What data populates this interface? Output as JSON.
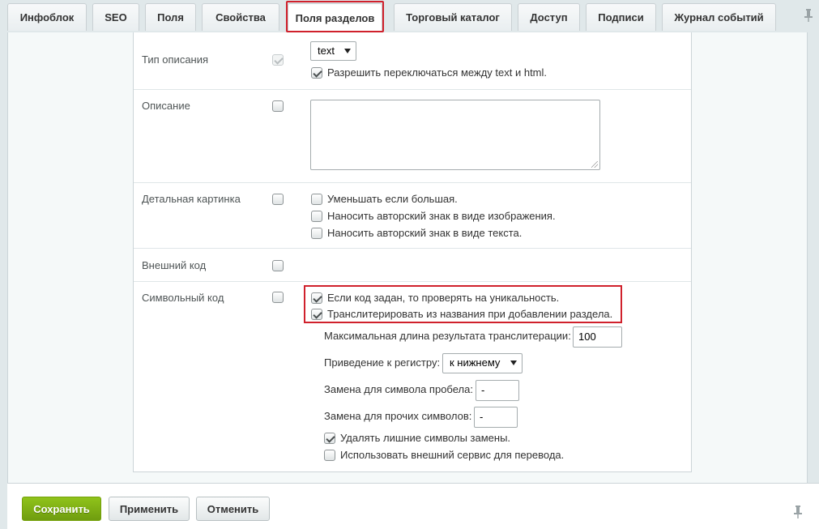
{
  "tabs": [
    {
      "label": "Инфоблок"
    },
    {
      "label": "SEO"
    },
    {
      "label": "Поля"
    },
    {
      "label": "Свойства"
    },
    {
      "label": "Поля разделов"
    },
    {
      "label": "Торговый каталог"
    },
    {
      "label": "Доступ"
    },
    {
      "label": "Подписи"
    },
    {
      "label": "Журнал событий"
    }
  ],
  "active_tab": "Поля разделов",
  "fields": {
    "description_type": {
      "label": "Тип описания",
      "required_checked": true,
      "required_disabled": true,
      "select_value": "text",
      "allow_switch_label": "Разрешить переключаться между text и html.",
      "allow_switch_checked": true
    },
    "description": {
      "label": "Описание",
      "required_checked": false,
      "textarea_value": ""
    },
    "detail_picture": {
      "label": "Детальная картинка",
      "required_checked": false,
      "options": [
        {
          "label": "Уменьшать если большая.",
          "checked": false
        },
        {
          "label": "Наносить авторский знак в виде изображения.",
          "checked": false
        },
        {
          "label": "Наносить авторский знак в виде текста.",
          "checked": false
        }
      ]
    },
    "external_code": {
      "label": "Внешний код",
      "required_checked": false
    },
    "symbol_code": {
      "label": "Символьный код",
      "required_checked": false,
      "options": [
        {
          "label": "Если код задан, то проверять на уникальность.",
          "checked": true
        },
        {
          "label": "Транслитерировать из названия при добавлении раздела.",
          "checked": true
        }
      ],
      "max_length_label": "Максимальная длина результата транслитерации:",
      "max_length_value": "100",
      "case_label": "Приведение к регистру:",
      "case_value": "к нижнему",
      "space_replace_label": "Замена для символа пробела:",
      "space_replace_value": "-",
      "other_replace_label": "Замена для прочих символов:",
      "other_replace_value": "-",
      "extra_options": [
        {
          "label": "Удалять лишние символы замены.",
          "checked": true
        },
        {
          "label": "Использовать внешний сервис для перевода.",
          "checked": false
        }
      ]
    }
  },
  "footer": {
    "save_label": "Сохранить",
    "apply_label": "Применить",
    "cancel_label": "Отменить"
  },
  "colors": {
    "accent_green": "#7fb014",
    "highlight_red": "#d0212c",
    "background": "#e0e8ea"
  }
}
